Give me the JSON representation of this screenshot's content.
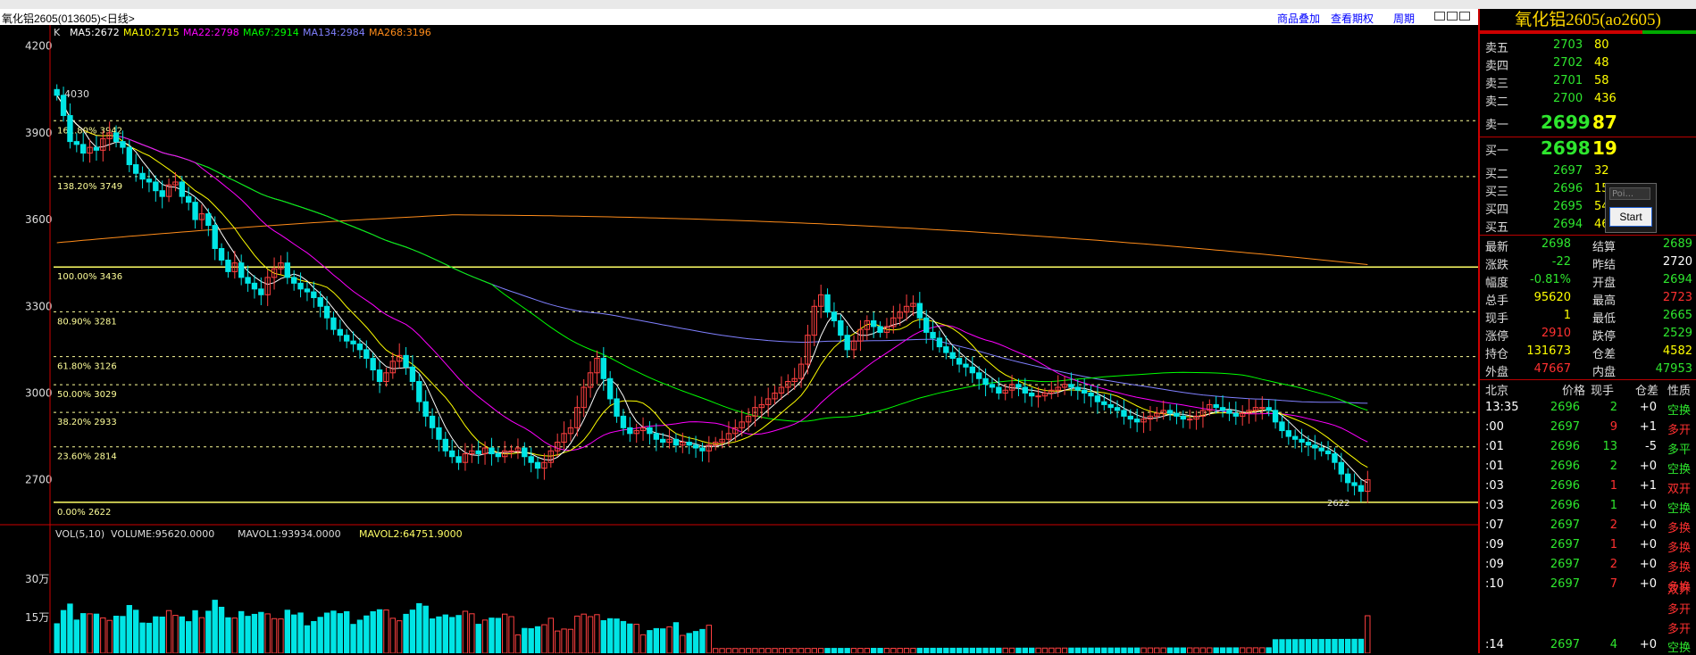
{
  "title": "氧化铝2605(013605)<日线>",
  "links": [
    "商品叠加",
    "查看期权",
    "周期"
  ],
  "indicator": {
    "k_label": "K",
    "ma": [
      {
        "label": "MA5:2672",
        "color": "#ffffff"
      },
      {
        "label": "MA10:2715",
        "color": "#ffff00"
      },
      {
        "label": "MA22:2798",
        "color": "#ff00ff"
      },
      {
        "label": "MA67:2914",
        "color": "#00ff00"
      },
      {
        "label": "MA134:2984",
        "color": "#8080ff"
      },
      {
        "label": "MA268:3196",
        "color": "#ff8c1a"
      }
    ]
  },
  "price_axis": [
    "4200",
    "3900",
    "3600",
    "3300",
    "3000",
    "2700"
  ],
  "price_marks": {
    "high": "4030",
    "low": "2622"
  },
  "fib_levels": [
    {
      "label": "161.80% 3942",
      "value": 3942
    },
    {
      "label": "138.20% 3749",
      "value": 3749
    },
    {
      "label": "100.00% 3436",
      "value": 3436
    },
    {
      "label": "80.90% 3281",
      "value": 3281
    },
    {
      "label": "61.80% 3126",
      "value": 3126
    },
    {
      "label": "50.00% 3029",
      "value": 3029
    },
    {
      "label": "38.20% 2933",
      "value": 2933
    },
    {
      "label": "23.60% 2814",
      "value": 2814
    },
    {
      "label": "0.00% 2622",
      "value": 2622
    }
  ],
  "volume": {
    "header": "VOL(5,10)",
    "volume_text": "VOLUME:95620.0000",
    "mavol1": "MAVOL1:93934.0000",
    "mavol2": "MAVOL2:64751.9000",
    "axis": [
      "30万",
      "15万"
    ]
  },
  "chart_data": {
    "type": "candlestick",
    "ylim": [
      2560,
      4230
    ],
    "closes": [
      4030,
      3960,
      3870,
      3860,
      3830,
      3850,
      3840,
      3880,
      3900,
      3870,
      3850,
      3790,
      3760,
      3740,
      3730,
      3700,
      3680,
      3720,
      3730,
      3680,
      3660,
      3600,
      3620,
      3580,
      3500,
      3460,
      3420,
      3450,
      3400,
      3380,
      3360,
      3340,
      3400,
      3430,
      3450,
      3400,
      3380,
      3360,
      3350,
      3330,
      3300,
      3260,
      3220,
      3200,
      3180,
      3170,
      3150,
      3120,
      3080,
      3040,
      3070,
      3110,
      3130,
      3090,
      3040,
      2970,
      2920,
      2880,
      2840,
      2800,
      2780,
      2760,
      2790,
      2800,
      2790,
      2810,
      2790,
      2780,
      2800,
      2800,
      2810,
      2780,
      2760,
      2740,
      2760,
      2800,
      2830,
      2860,
      2880,
      2950,
      3020,
      3070,
      3120,
      3050,
      2980,
      2920,
      2880,
      2860,
      2870,
      2880,
      2860,
      2840,
      2830,
      2840,
      2820,
      2830,
      2820,
      2810,
      2800,
      2820,
      2830,
      2840,
      2860,
      2880,
      2900,
      2920,
      2950,
      2960,
      2980,
      3000,
      3020,
      3040,
      3050,
      3100,
      3200,
      3300,
      3340,
      3280,
      3250,
      3200,
      3150,
      3180,
      3220,
      3250,
      3230,
      3210,
      3230,
      3260,
      3280,
      3300,
      3310,
      3260,
      3210,
      3190,
      3160,
      3140,
      3120,
      3100,
      3090,
      3070,
      3050,
      3030,
      3020,
      3000,
      3010,
      3030,
      3020,
      3000,
      2990,
      2990,
      3000,
      3010,
      3020,
      3030,
      3020,
      3010,
      3000,
      2990,
      2970,
      2960,
      2950,
      2940,
      2920,
      2910,
      2900,
      2910,
      2920,
      2930,
      2940,
      2930,
      2920,
      2910,
      2910,
      2920,
      2940,
      2960,
      2950,
      2940,
      2930,
      2920,
      2930,
      2940,
      2950,
      2950,
      2940,
      2900,
      2870,
      2850,
      2840,
      2830,
      2820,
      2810,
      2800,
      2790,
      2760,
      2720,
      2690,
      2680,
      2660,
      2700
    ],
    "volume_series": {
      "MAVOL1": 93934,
      "MAVOL2": 64751.9,
      "VOLUME": 95620
    }
  },
  "quote": {
    "title": "氧化铝2605(ao2605)",
    "asks": [
      {
        "label": "卖五",
        "price": "2703",
        "vol": "80"
      },
      {
        "label": "卖四",
        "price": "2702",
        "vol": "48"
      },
      {
        "label": "卖三",
        "price": "2701",
        "vol": "58"
      },
      {
        "label": "卖二",
        "price": "2700",
        "vol": "436"
      },
      {
        "label": "卖一",
        "price": "2699",
        "vol": "87"
      }
    ],
    "bids": [
      {
        "label": "买一",
        "price": "2698",
        "vol": "19"
      },
      {
        "label": "买二",
        "price": "2697",
        "vol": "32"
      },
      {
        "label": "买三",
        "price": "2696",
        "vol": "15"
      },
      {
        "label": "买四",
        "price": "2695",
        "vol": "54"
      },
      {
        "label": "买五",
        "price": "2694",
        "vol": "46"
      }
    ],
    "stats": [
      {
        "l1": "最新",
        "v1": "2698",
        "c1": "grn",
        "l2": "结算",
        "v2": "2689",
        "c2": "grn"
      },
      {
        "l1": "涨跌",
        "v1": "-22",
        "c1": "grn",
        "l2": "昨结",
        "v2": "2720",
        "c2": "wht"
      },
      {
        "l1": "幅度",
        "v1": "-0.81%",
        "c1": "grn",
        "l2": "开盘",
        "v2": "2694",
        "c2": "grn"
      },
      {
        "l1": "总手",
        "v1": "95620",
        "c1": "yel",
        "l2": "最高",
        "v2": "2723",
        "c2": "red"
      },
      {
        "l1": "现手",
        "v1": "1",
        "c1": "yel",
        "l2": "最低",
        "v2": "2665",
        "c2": "grn"
      },
      {
        "l1": "涨停",
        "v1": "2910",
        "c1": "red",
        "l2": "跌停",
        "v2": "2529",
        "c2": "grn"
      },
      {
        "l1": "持仓",
        "v1": "131673",
        "c1": "yel",
        "l2": "仓差",
        "v2": "4582",
        "c2": "yel"
      },
      {
        "l1": "外盘",
        "v1": "47667",
        "c1": "red",
        "l2": "内盘",
        "v2": "47953",
        "c2": "grn"
      }
    ],
    "ticks_header": {
      "time": "北京",
      "price": "价格",
      "now": "现手",
      "diff": "仓差",
      "nature": "性质"
    },
    "ticks": [
      {
        "time": "13:35",
        "price": "2696",
        "now": "2",
        "diff": "+0",
        "nature": "空换",
        "nc": "grn"
      },
      {
        "time": ":00",
        "price": "2697",
        "now": "9",
        "diff": "+1",
        "nature": "多开",
        "nc": "red"
      },
      {
        "time": ":01",
        "price": "2696",
        "now": "13",
        "diff": "-5",
        "nature": "多平",
        "nc": "grn"
      },
      {
        "time": ":01",
        "price": "2696",
        "now": "2",
        "diff": "+0",
        "nature": "空换",
        "nc": "grn"
      },
      {
        "time": ":03",
        "price": "2696",
        "now": "1",
        "diff": "+1",
        "nature": "双开",
        "nc": "red"
      },
      {
        "time": ":03",
        "price": "2696",
        "now": "1",
        "diff": "+0",
        "nature": "空换",
        "nc": "grn"
      },
      {
        "time": ":07",
        "price": "2697",
        "now": "2",
        "diff": "+0",
        "nature": "多换",
        "nc": "red"
      },
      {
        "time": ":09",
        "price": "2697",
        "now": "1",
        "diff": "+0",
        "nature": "多换",
        "nc": "red"
      },
      {
        "time": ":09",
        "price": "2697",
        "now": "2",
        "diff": "+0",
        "nature": "多换",
        "nc": "red"
      },
      {
        "time": ":10",
        "price": "2697",
        "now": "7",
        "diff": "+0",
        "nature": "多换",
        "nc": "red"
      },
      {
        "time": "",
        "price": "",
        "now": "",
        "diff": "",
        "nature": "双开",
        "nc": "red"
      },
      {
        "time": "",
        "price": "",
        "now": "",
        "diff": "",
        "nature": "多开",
        "nc": "red"
      },
      {
        "time": "",
        "price": "",
        "now": "",
        "diff": "",
        "nature": "多开",
        "nc": "red"
      },
      {
        "time": ":14",
        "price": "2697",
        "now": "4",
        "diff": "+0",
        "nature": "空换",
        "nc": "grn"
      }
    ]
  },
  "popup": {
    "input_placeholder": "Poi...",
    "button": "Start"
  }
}
